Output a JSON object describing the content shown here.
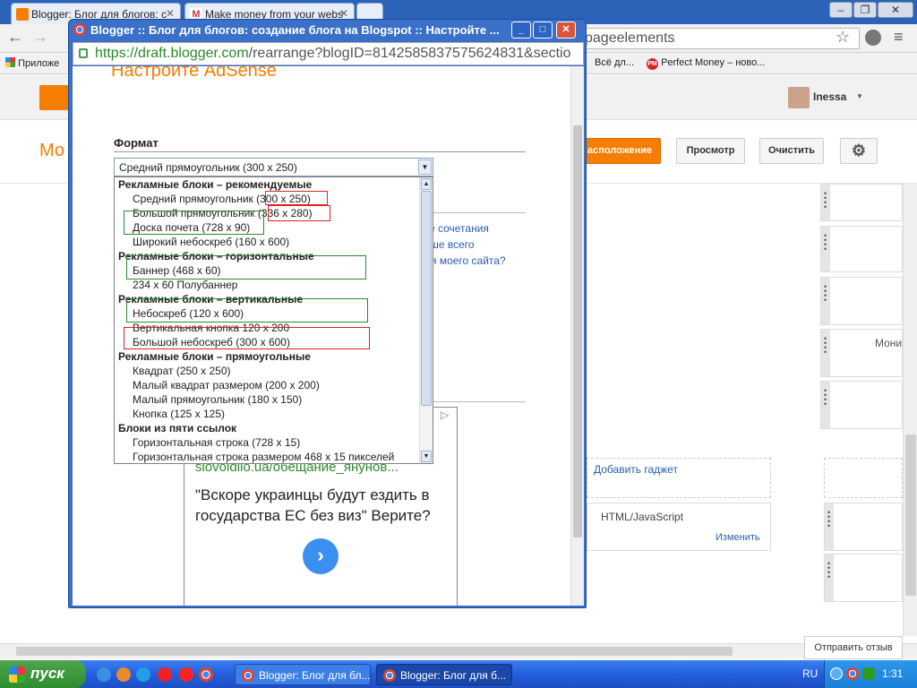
{
  "browser": {
    "tabs": [
      {
        "title": "Blogger: Блог для блогов: с"
      },
      {
        "title": "Make money from your webs"
      }
    ],
    "omnibox_suffix": "pageelements",
    "bookmarks": [
      {
        "label": "Приложе"
      },
      {
        "label": "Всё дл..."
      },
      {
        "label": "Perfect Money – ново..."
      }
    ]
  },
  "blogger": {
    "user_name": "Inessa",
    "page_title": "Мо",
    "buttons": {
      "layout": "асположение",
      "preview": "Просмотр",
      "clear": "Очистить"
    },
    "gadget_right_label": "Мони",
    "add_gadget": "Добавить гаджет",
    "html_gadget_title": "HTML/JavaScript",
    "html_gadget_edit": "Изменить",
    "feedback": "Отправить отзыв"
  },
  "popup": {
    "title": "Blogger :: Блог для блогов: создание блога на Blogspot :: Настройте ...",
    "url_host": "https://draft.blogger.com",
    "url_path": "/rearrange?blogID=8142585837575624831&sectio",
    "heading": "Настройте AdSense",
    "format_label": "Формат",
    "selected_format": "Средний прямоугольник (300 x 250)",
    "dropdown": [
      {
        "type": "group",
        "label": "Рекламные блоки – рекомендуемые"
      },
      {
        "type": "option",
        "label": "Средний прямоугольник (300 x 250)"
      },
      {
        "type": "option",
        "label": "Большой прямоугольник (336 x 280)"
      },
      {
        "type": "option",
        "label": "Доска почета (728 x 90)"
      },
      {
        "type": "option",
        "label": "Широкий небоскреб (160 x 600)"
      },
      {
        "type": "group",
        "label": "Рекламные блоки – горизонтальные"
      },
      {
        "type": "option",
        "label": "Баннер (468 x 60)"
      },
      {
        "type": "option",
        "label": "234 x 60 Полубаннер"
      },
      {
        "type": "group",
        "label": "Рекламные блоки – вертикальные"
      },
      {
        "type": "option",
        "label": "Небоскреб (120 x 600)"
      },
      {
        "type": "option",
        "label": "Вертикальная кнопка 120 x 200"
      },
      {
        "type": "option",
        "label": "Большой небоскреб (300 x 600)"
      },
      {
        "type": "group",
        "label": "Рекламные блоки – прямоугольные"
      },
      {
        "type": "option",
        "label": "Квадрат (250 x 250)"
      },
      {
        "type": "option",
        "label": "Малый квадрат размером (200 x 200)"
      },
      {
        "type": "option",
        "label": "Малый прямоугольник (180 x 150)"
      },
      {
        "type": "option",
        "label": "Кнопка (125 x 125)"
      },
      {
        "type": "group",
        "label": "Блоки из пяти ссылок"
      },
      {
        "type": "option",
        "label": "Горизонтальная строка (728 x 15)"
      },
      {
        "type": "option",
        "label": "Горизонтальная строка размером 468 x 15 пикселей"
      }
    ],
    "right_links": [
      "кие сочетания",
      "льше всего",
      "для моего сайта?"
    ],
    "ad": {
      "url": "slovoidilo.ua/обещание_янунов...",
      "text": "\"Вскоре украинцы будут ездить в государства ЕС без виз\" Верите?"
    }
  },
  "taskbar": {
    "start_label": "пуск",
    "tasks": [
      {
        "title": "Blogger: Блог для бл..."
      },
      {
        "title": "Blogger: Блог для б..."
      }
    ],
    "language": "RU",
    "clock": "1:31"
  },
  "colors": {
    "accent_orange": "#f57d00",
    "highlight_red": "#dd2222",
    "highlight_green": "#2a8a2a",
    "link_blue": "#2a5db0"
  }
}
